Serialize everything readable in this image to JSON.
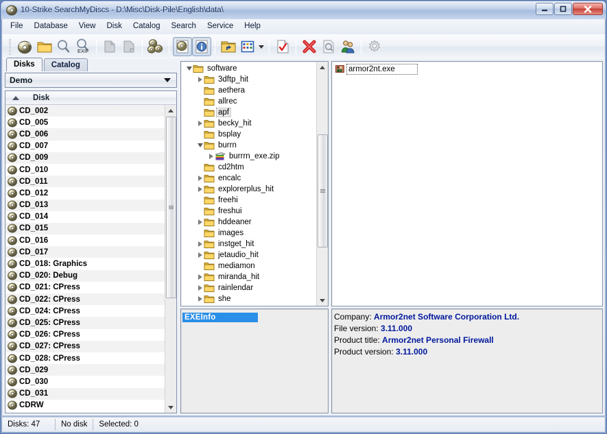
{
  "window": {
    "title": "10-Strike SearchMyDiscs - D:\\Misc\\Disk-Pile\\English\\data\\",
    "icon": "cd-disc-icon",
    "controls": {
      "minimize": "—",
      "maximize": "❐",
      "close": "✕"
    },
    "accent": "#4a6da8"
  },
  "menubar": {
    "items": [
      {
        "label": "File"
      },
      {
        "label": "Database"
      },
      {
        "label": "View"
      },
      {
        "label": "Disk"
      },
      {
        "label": "Catalog"
      },
      {
        "label": "Search"
      },
      {
        "label": "Service"
      },
      {
        "label": "Help"
      }
    ]
  },
  "toolbar": {
    "buttons": [
      {
        "name": "add-disk-icon",
        "tooltip": "Add disk"
      },
      {
        "name": "open-folder-icon",
        "tooltip": "Open folder"
      },
      {
        "name": "search-icon",
        "tooltip": "Search"
      },
      {
        "name": "search-exif-icon",
        "tooltip": "EXIF search"
      },
      {
        "name": "copy-icon",
        "tooltip": "Copy",
        "disabled": true
      },
      {
        "name": "paste-icon",
        "tooltip": "Paste",
        "disabled": true
      },
      {
        "name": "disk-group-icon",
        "tooltip": "Disk group"
      },
      {
        "name": "disk-properties-icon",
        "tooltip": "Disk properties",
        "pressed": true
      },
      {
        "name": "info-icon",
        "tooltip": "Info",
        "pressed": true
      },
      {
        "name": "folder-up-icon",
        "tooltip": "Up one level"
      },
      {
        "name": "view-mode-icon",
        "tooltip": "View mode"
      },
      {
        "name": "check-report-icon",
        "tooltip": "Report"
      },
      {
        "name": "delete-icon",
        "tooltip": "Delete"
      },
      {
        "name": "preview-icon",
        "tooltip": "Preview",
        "disabled": true
      },
      {
        "name": "users-icon",
        "tooltip": "Users"
      },
      {
        "name": "settings-gear-icon",
        "tooltip": "Settings",
        "disabled": true
      }
    ]
  },
  "tabs": [
    {
      "label": "Disks",
      "active": true
    },
    {
      "label": "Catalog",
      "active": false
    }
  ],
  "left_panel": {
    "combo": {
      "value": "Demo",
      "options": [
        "Demo"
      ]
    },
    "column_header": "Disk",
    "sort": "ascending",
    "disks": [
      "CD_002",
      "CD_005",
      "CD_006",
      "CD_007",
      "CD_009",
      "CD_010",
      "CD_011",
      "CD_012",
      "CD_013",
      "CD_014",
      "CD_015",
      "CD_016",
      "CD_017",
      "CD_018: Graphics",
      "CD_020: Debug",
      "CD_021: CPress",
      "CD_022: CPress",
      "CD_024: CPress",
      "CD_025: CPress",
      "CD_026: CPress",
      "CD_027: CPress",
      "CD_028: CPress",
      "CD_029",
      "CD_030",
      "CD_031",
      "CDRW"
    ]
  },
  "tree_panel": {
    "nodes": [
      {
        "label": "software",
        "indent": 0,
        "state": "open",
        "icon": "folder-icon",
        "selected": false
      },
      {
        "label": "3dftp_hit",
        "indent": 1,
        "state": "closed",
        "icon": "folder-icon",
        "selected": false
      },
      {
        "label": "aethera",
        "indent": 1,
        "state": "leaf",
        "icon": "folder-icon",
        "selected": false
      },
      {
        "label": "allrec",
        "indent": 1,
        "state": "leaf",
        "icon": "folder-icon",
        "selected": false
      },
      {
        "label": "apf",
        "indent": 1,
        "state": "leaf",
        "icon": "folder-icon",
        "selected": true
      },
      {
        "label": "becky_hit",
        "indent": 1,
        "state": "closed",
        "icon": "folder-icon",
        "selected": false
      },
      {
        "label": "bsplay",
        "indent": 1,
        "state": "leaf",
        "icon": "folder-icon",
        "selected": false
      },
      {
        "label": "burrn",
        "indent": 1,
        "state": "open",
        "icon": "folder-icon",
        "selected": false
      },
      {
        "label": "burrrn_exe.zip",
        "indent": 2,
        "state": "closed",
        "icon": "zip-archive-icon",
        "selected": false
      },
      {
        "label": "cd2htm",
        "indent": 1,
        "state": "leaf",
        "icon": "folder-icon",
        "selected": false
      },
      {
        "label": "encalc",
        "indent": 1,
        "state": "closed",
        "icon": "folder-icon",
        "selected": false
      },
      {
        "label": "explorerplus_hit",
        "indent": 1,
        "state": "closed",
        "icon": "folder-icon",
        "selected": false
      },
      {
        "label": "freehi",
        "indent": 1,
        "state": "leaf",
        "icon": "folder-icon",
        "selected": false
      },
      {
        "label": "freshui",
        "indent": 1,
        "state": "leaf",
        "icon": "folder-icon",
        "selected": false
      },
      {
        "label": "hddeaner",
        "indent": 1,
        "state": "closed",
        "icon": "folder-icon",
        "selected": false
      },
      {
        "label": "images",
        "indent": 1,
        "state": "leaf",
        "icon": "folder-icon",
        "selected": false
      },
      {
        "label": "instget_hit",
        "indent": 1,
        "state": "closed",
        "icon": "folder-icon",
        "selected": false
      },
      {
        "label": "jetaudio_hit",
        "indent": 1,
        "state": "closed",
        "icon": "folder-icon",
        "selected": false
      },
      {
        "label": "mediamon",
        "indent": 1,
        "state": "leaf",
        "icon": "folder-icon",
        "selected": false
      },
      {
        "label": "miranda_hit",
        "indent": 1,
        "state": "closed",
        "icon": "folder-icon",
        "selected": false
      },
      {
        "label": "rainlendar",
        "indent": 1,
        "state": "closed",
        "icon": "folder-icon",
        "selected": false
      },
      {
        "label": "she",
        "indent": 1,
        "state": "closed",
        "icon": "folder-icon",
        "selected": false
      }
    ]
  },
  "exeinfo_panel": {
    "items": [
      {
        "label": "EXEInfo",
        "selected": true
      }
    ]
  },
  "file_panel": {
    "files": [
      {
        "name": "armor2nt.exe",
        "icon": "exe-file-icon",
        "selected": true
      }
    ]
  },
  "details_panel": {
    "rows": [
      {
        "label": "Company:",
        "value": "Armor2net Software Corporation Ltd."
      },
      {
        "label": "File version:",
        "value": "3.11.000"
      },
      {
        "label": "Product title:",
        "value": "Armor2net Personal Firewall"
      },
      {
        "label": "Product version:",
        "value": "3.11.000"
      }
    ],
    "value_color": "#00189c"
  },
  "statusbar": {
    "cells": [
      "Disks: 47",
      "No disk",
      "Selected: 0"
    ]
  }
}
